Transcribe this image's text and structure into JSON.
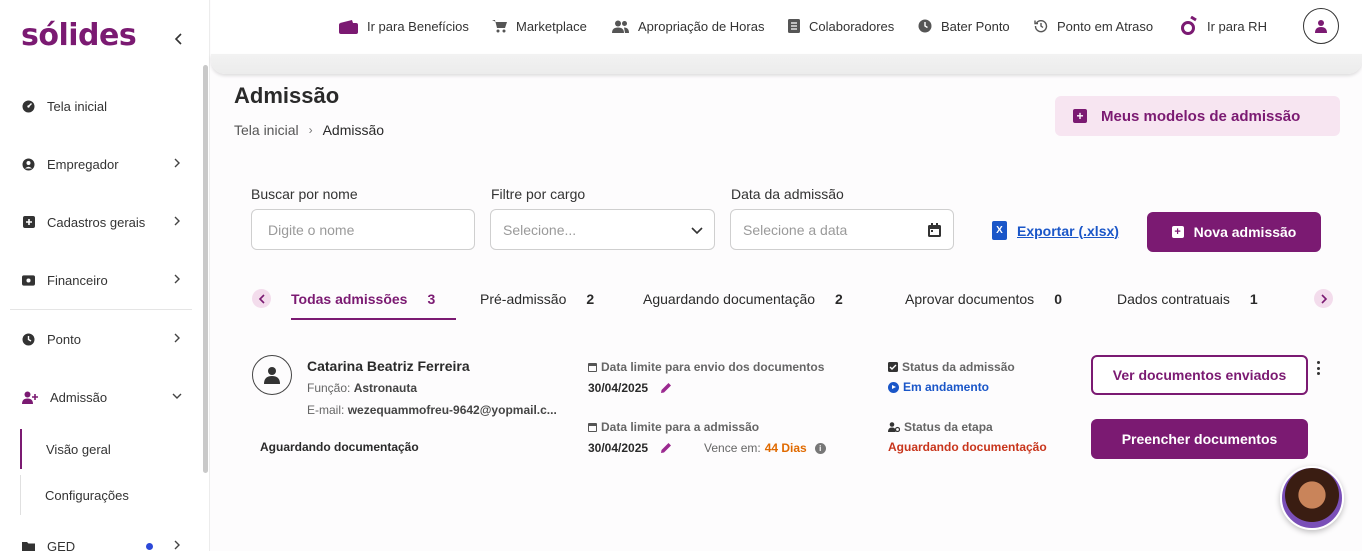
{
  "sidebar": {
    "logo": "sólides",
    "items": [
      {
        "label": "Tela inicial"
      },
      {
        "label": "Empregador"
      },
      {
        "label": "Cadastros gerais"
      },
      {
        "label": "Financeiro"
      },
      {
        "label": "Ponto"
      },
      {
        "label": "Admissão"
      },
      {
        "label": "GED"
      }
    ],
    "subitems": [
      {
        "label": "Visão geral"
      },
      {
        "label": "Configurações"
      }
    ]
  },
  "topnav": {
    "items": [
      {
        "label": "Ir para Benefícios"
      },
      {
        "label": "Marketplace"
      },
      {
        "label": "Apropriação de Horas"
      },
      {
        "label": "Colaboradores"
      },
      {
        "label": "Bater Ponto"
      },
      {
        "label": "Ponto em Atraso"
      },
      {
        "label": "Ir para RH"
      }
    ]
  },
  "header": {
    "title": "Admissão",
    "breadcrumb": [
      "Tela inicial",
      "Admissão"
    ],
    "models_button": "Meus modelos de admissão"
  },
  "filters": {
    "name_label": "Buscar por nome",
    "name_placeholder": "Digite o nome",
    "role_label": "Filtre por cargo",
    "role_value": "Selecione...",
    "date_label": "Data da admissão",
    "date_placeholder": "Selecione a data",
    "export_label": "Exportar (.xlsx)",
    "new_button": "Nova admissão"
  },
  "tabs": [
    {
      "label": "Todas admissões",
      "count": "3"
    },
    {
      "label": "Pré-admissão",
      "count": "2"
    },
    {
      "label": "Aguardando documentação",
      "count": "2"
    },
    {
      "label": "Aprovar documentos",
      "count": "0"
    },
    {
      "label": "Dados contratuais",
      "count": "1"
    }
  ],
  "card": {
    "name": "Catarina Beatriz Ferreira",
    "role_prefix": "Função:",
    "role": "Astronauta",
    "email_prefix": "E-mail:",
    "email": "wezequammofreu-9642@yopmail.c...",
    "status": "Aguardando documentação",
    "doc_deadline_label": "Data limite para envio dos documentos",
    "doc_deadline": "30/04/2025",
    "adm_deadline_label": "Data limite para a admissão",
    "adm_deadline": "30/04/2025",
    "expires_label": "Vence em:",
    "expires_value": "44 Dias",
    "admission_status_label": "Status da admissão",
    "admission_status": "Em andamento",
    "stage_status_label": "Status da etapa",
    "stage_status": "Aguardando documentação",
    "view_button": "Ver documentos enviados",
    "fill_button": "Preencher documentos"
  }
}
